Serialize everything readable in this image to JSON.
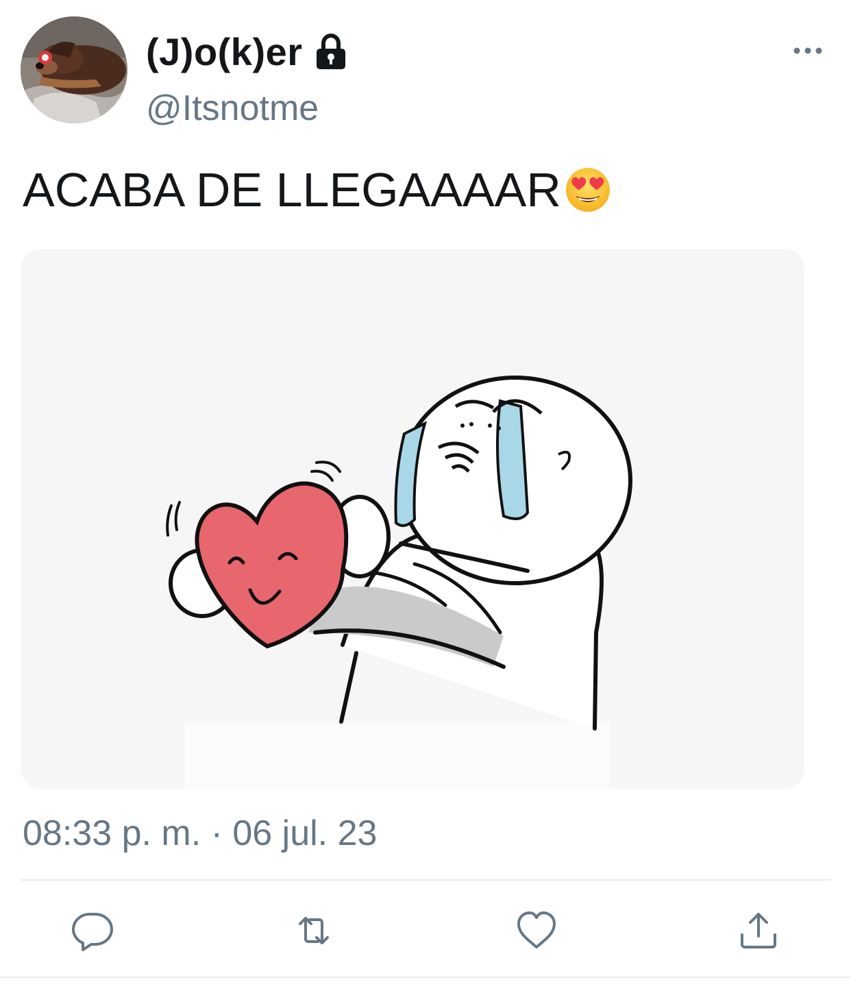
{
  "tweet": {
    "display_name": "(J)o(k)er",
    "handle": "@Itsnotme",
    "protected": true,
    "text": "ACABA DE LLEGAAAAR",
    "text_emoji": "smiling-face-with-heart-eyes-icon",
    "timestamp": "08:33 p. m. · 06 jul. 23"
  },
  "icons": {
    "lock": "lock-icon",
    "more": "more-options-icon",
    "reply": "reply-icon",
    "retweet": "retweet-icon",
    "like": "heart-icon",
    "share": "share-icon"
  },
  "colors": {
    "text_primary": "#14171a",
    "text_secondary": "#657786",
    "icon_gray": "#657786",
    "divider": "#e6ecf0",
    "heart_red": "#e8666e",
    "tear_blue": "#a8d8e8"
  }
}
